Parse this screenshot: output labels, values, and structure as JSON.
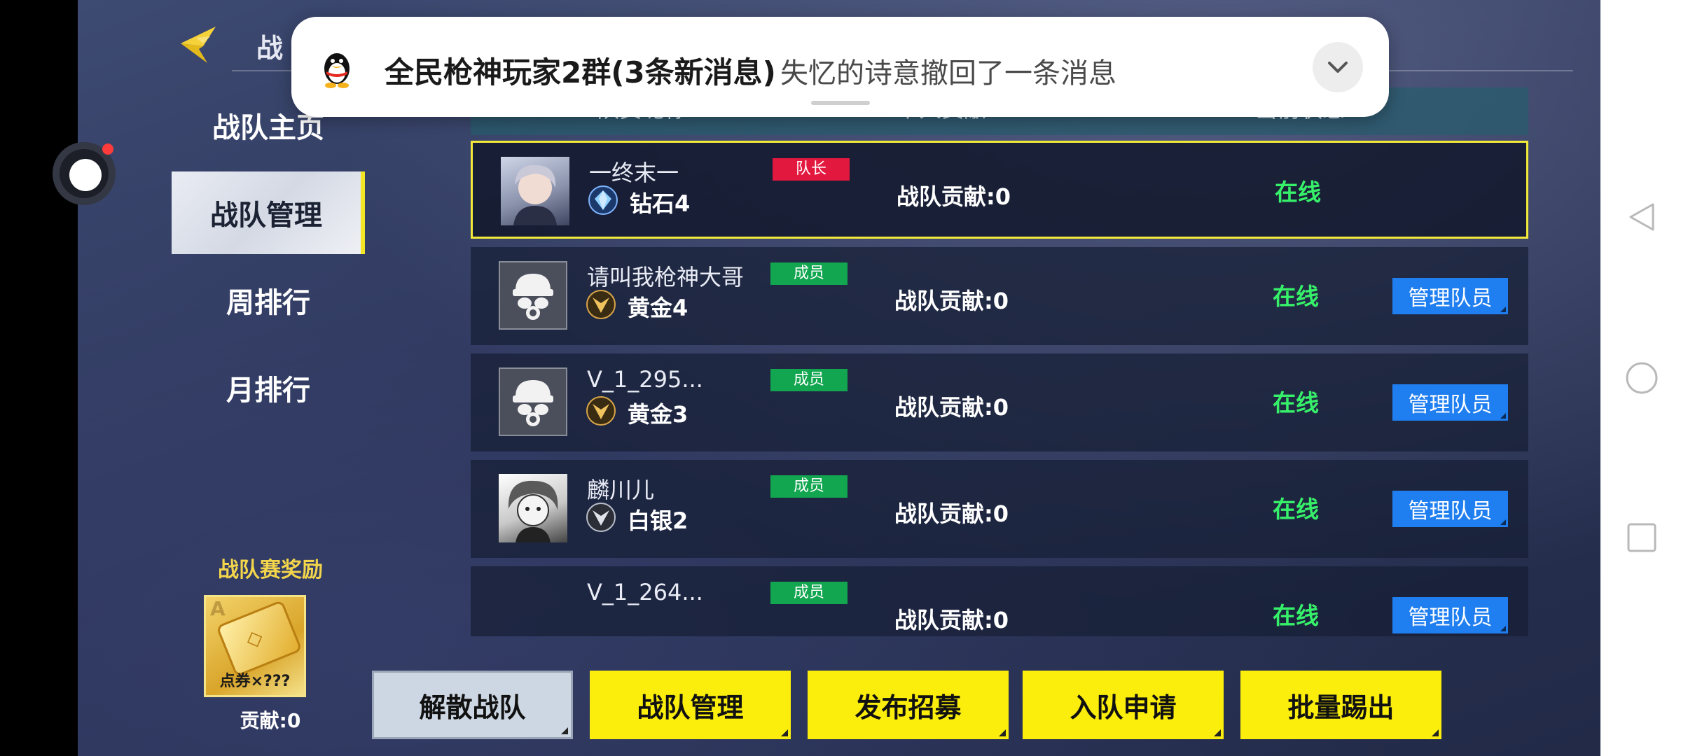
{
  "header": {
    "title": "战"
  },
  "menu": {
    "items": [
      {
        "label": "战队主页",
        "active": false
      },
      {
        "label": "战队管理",
        "active": true
      },
      {
        "label": "周排行",
        "active": false
      },
      {
        "label": "月排行",
        "active": false
      }
    ]
  },
  "reward": {
    "title": "战队赛奖励",
    "grade": "A",
    "count": "点券×???",
    "contribution": "贡献:0"
  },
  "table": {
    "headers": [
      "队员昵称",
      "个人贡献",
      "当前状态"
    ],
    "members": [
      {
        "name": "一终末一",
        "role": "队长",
        "rank": "钻石4",
        "rank_icon": "diamond-rank-icon",
        "contribution": "战队贡献:0",
        "status": "在线",
        "avatar": "anime-avatar"
      },
      {
        "name": "请叫我枪神大哥",
        "role": "成员",
        "rank": "黄金4",
        "rank_icon": "gold-rank-icon",
        "contribution": "战队贡献:0",
        "status": "在线",
        "manage": "管理队员",
        "avatar": "gas-mask-avatar"
      },
      {
        "name": "V_1_295...",
        "role": "成员",
        "rank": "黄金3",
        "rank_icon": "gold-rank-icon",
        "contribution": "战队贡献:0",
        "status": "在线",
        "manage": "管理队员",
        "avatar": "gas-mask-avatar"
      },
      {
        "name": "麟川儿",
        "role": "成员",
        "rank": "白银2",
        "rank_icon": "silver-rank-icon",
        "contribution": "战队贡献:0",
        "status": "在线",
        "manage": "管理队员",
        "avatar": "anime-avatar"
      },
      {
        "name": "V_1_264...",
        "role": "成员",
        "rank": "",
        "contribution": "战队贡献:0",
        "status": "在线",
        "manage": "管理队员",
        "avatar": ""
      }
    ]
  },
  "actions": {
    "disband": "解散战队",
    "manage": "战队管理",
    "recruit": "发布招募",
    "requests": "入队申请",
    "batch_kick": "批量踢出"
  },
  "notification": {
    "app_icon": "qq-penguin-icon",
    "title": "全民枪神玩家2群(3条新消息)",
    "message": "失忆的诗意撤回了一条消息"
  },
  "colors": {
    "leader_badge": "#e3183f",
    "member_badge": "#12a650",
    "online": "#37f06a",
    "manage_button": "#1f7ef0",
    "action_button": "#fbee0c",
    "selected_row_border": "#f3e93a"
  }
}
